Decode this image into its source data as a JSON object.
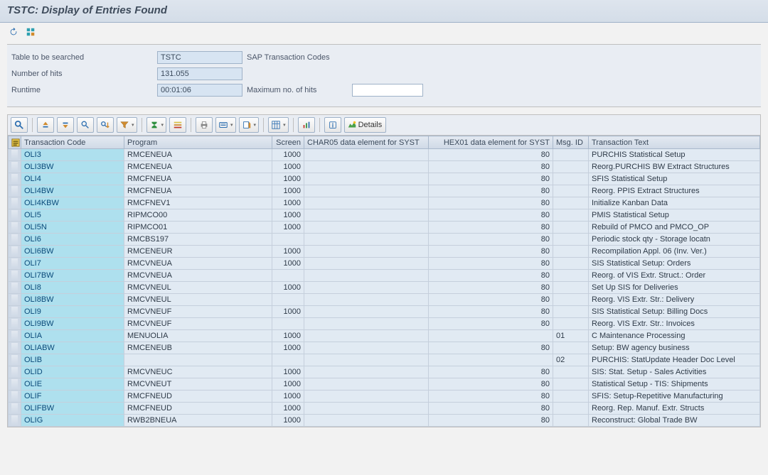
{
  "header": {
    "title": "TSTC: Display of Entries Found"
  },
  "info": {
    "table_label": "Table to be searched",
    "table_value": "TSTC",
    "table_desc": "SAP Transaction Codes",
    "hits_label": "Number of hits",
    "hits_value": "131.055",
    "runtime_label": "Runtime",
    "runtime_value": "00:01:06",
    "maxhits_label": "Maximum no. of hits",
    "maxhits_value": ""
  },
  "toolbar": {
    "details_label": "Details"
  },
  "columns": {
    "tcode": "Transaction Code",
    "program": "Program",
    "screen": "Screen",
    "char05": "CHAR05 data element for SYST",
    "hex01": "HEX01 data element for SYST",
    "msgid": "Msg. ID",
    "ttext": "Transaction Text"
  },
  "rows": [
    {
      "tcode": "OLI3",
      "program": "RMCENEUA",
      "screen": "1000",
      "char05": "",
      "hex01": "80",
      "msgid": "",
      "ttext": "PURCHIS Statistical Setup"
    },
    {
      "tcode": "OLI3BW",
      "program": "RMCENEUA",
      "screen": "1000",
      "char05": "",
      "hex01": "80",
      "msgid": "",
      "ttext": "Reorg.PURCHIS BW Extract Structures"
    },
    {
      "tcode": "OLI4",
      "program": "RMCFNEUA",
      "screen": "1000",
      "char05": "",
      "hex01": "80",
      "msgid": "",
      "ttext": "SFIS Statistical Setup"
    },
    {
      "tcode": "OLI4BW",
      "program": "RMCFNEUA",
      "screen": "1000",
      "char05": "",
      "hex01": "80",
      "msgid": "",
      "ttext": "Reorg. PPIS Extract Structures"
    },
    {
      "tcode": "OLI4KBW",
      "program": "RMCFNEV1",
      "screen": "1000",
      "char05": "",
      "hex01": "80",
      "msgid": "",
      "ttext": "Initialize Kanban Data"
    },
    {
      "tcode": "OLI5",
      "program": "RIPMCO00",
      "screen": "1000",
      "char05": "",
      "hex01": "80",
      "msgid": "",
      "ttext": "PMIS Statistical Setup"
    },
    {
      "tcode": "OLI5N",
      "program": "RIPMCO01",
      "screen": "1000",
      "char05": "",
      "hex01": "80",
      "msgid": "",
      "ttext": "Rebuild of PMCO and PMCO_OP"
    },
    {
      "tcode": "OLI6",
      "program": "RMCBS197",
      "screen": "",
      "char05": "",
      "hex01": "80",
      "msgid": "",
      "ttext": "Periodic stock qty - Storage locatn"
    },
    {
      "tcode": "OLI6BW",
      "program": "RMCENEUR",
      "screen": "1000",
      "char05": "",
      "hex01": "80",
      "msgid": "",
      "ttext": "Recompilation Appl. 06 (Inv. Ver.)"
    },
    {
      "tcode": "OLI7",
      "program": "RMCVNEUA",
      "screen": "1000",
      "char05": "",
      "hex01": "80",
      "msgid": "",
      "ttext": "SIS Statistical Setup: Orders"
    },
    {
      "tcode": "OLI7BW",
      "program": "RMCVNEUA",
      "screen": "",
      "char05": "",
      "hex01": "80",
      "msgid": "",
      "ttext": "Reorg. of VIS Extr. Struct.: Order"
    },
    {
      "tcode": "OLI8",
      "program": "RMCVNEUL",
      "screen": "1000",
      "char05": "",
      "hex01": "80",
      "msgid": "",
      "ttext": "Set Up SIS for Deliveries"
    },
    {
      "tcode": "OLI8BW",
      "program": "RMCVNEUL",
      "screen": "",
      "char05": "",
      "hex01": "80",
      "msgid": "",
      "ttext": "Reorg. VIS Extr. Str.: Delivery"
    },
    {
      "tcode": "OLI9",
      "program": "RMCVNEUF",
      "screen": "1000",
      "char05": "",
      "hex01": "80",
      "msgid": "",
      "ttext": "SIS Statistical Setup: Billing Docs"
    },
    {
      "tcode": "OLI9BW",
      "program": "RMCVNEUF",
      "screen": "",
      "char05": "",
      "hex01": "80",
      "msgid": "",
      "ttext": "Reorg. VIS Extr. Str.: Invoices"
    },
    {
      "tcode": "OLIA",
      "program": "MENUOLIA",
      "screen": "1000",
      "char05": "",
      "hex01": "",
      "msgid": "01",
      "ttext": "C Maintenance Processing"
    },
    {
      "tcode": "OLIABW",
      "program": "RMCENEUB",
      "screen": "1000",
      "char05": "",
      "hex01": "80",
      "msgid": "",
      "ttext": "Setup: BW agency business"
    },
    {
      "tcode": "OLIB",
      "program": "",
      "screen": "",
      "char05": "",
      "hex01": "",
      "msgid": "02",
      "ttext": "PURCHIS: StatUpdate Header Doc Level"
    },
    {
      "tcode": "OLID",
      "program": "RMCVNEUC",
      "screen": "1000",
      "char05": "",
      "hex01": "80",
      "msgid": "",
      "ttext": "SIS: Stat. Setup - Sales Activities"
    },
    {
      "tcode": "OLIE",
      "program": "RMCVNEUT",
      "screen": "1000",
      "char05": "",
      "hex01": "80",
      "msgid": "",
      "ttext": "Statistical Setup - TIS: Shipments"
    },
    {
      "tcode": "OLIF",
      "program": "RMCFNEUD",
      "screen": "1000",
      "char05": "",
      "hex01": "80",
      "msgid": "",
      "ttext": "SFIS: Setup-Repetitive Manufacturing"
    },
    {
      "tcode": "OLIFBW",
      "program": "RMCFNEUD",
      "screen": "1000",
      "char05": "",
      "hex01": "80",
      "msgid": "",
      "ttext": "Reorg. Rep. Manuf. Extr. Structs"
    },
    {
      "tcode": "OLIG",
      "program": "RWB2BNEUA",
      "screen": "1000",
      "char05": "",
      "hex01": "80",
      "msgid": "",
      "ttext": "Reconstruct: Global Trade BW"
    }
  ]
}
